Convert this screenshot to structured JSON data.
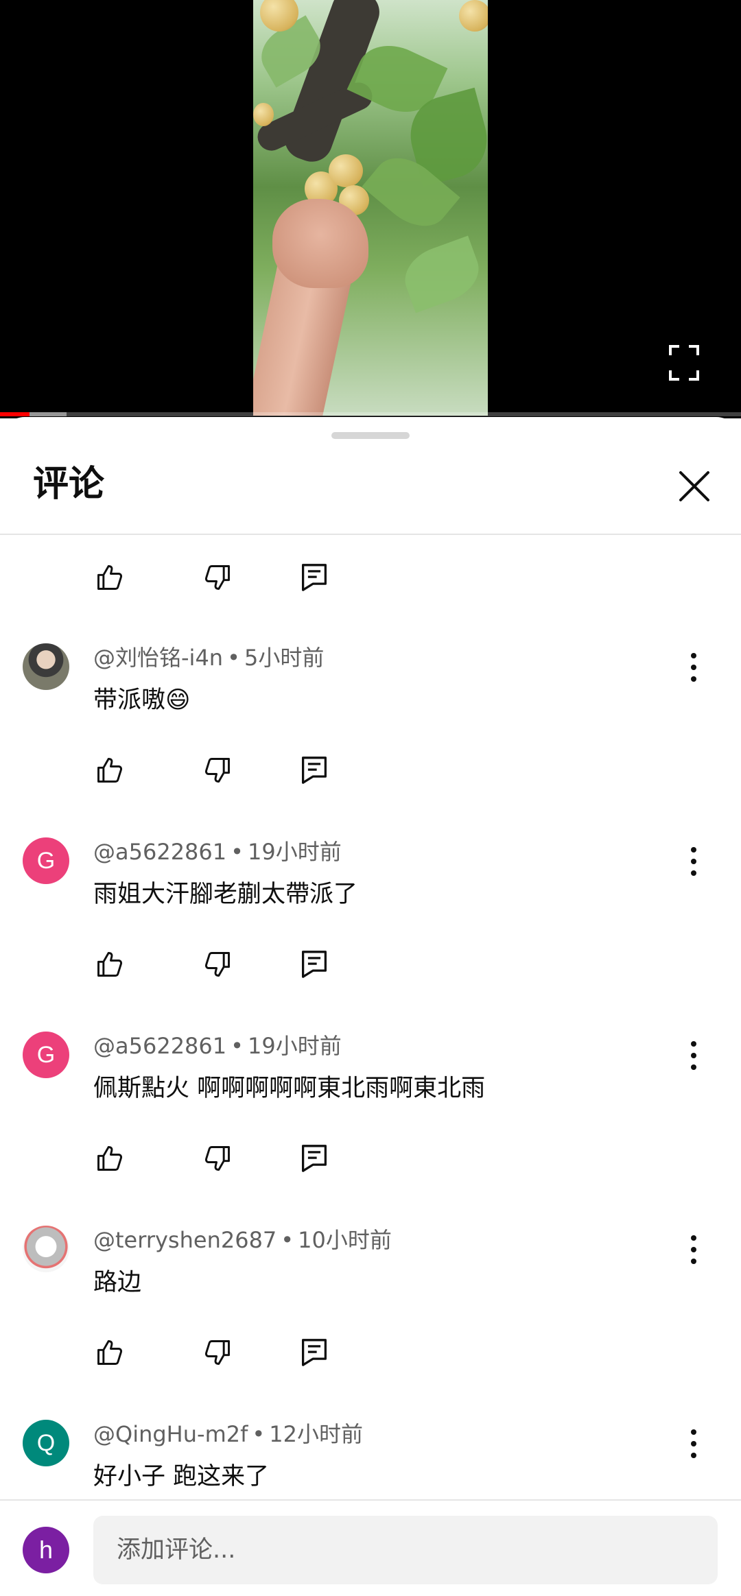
{
  "video": {
    "progress_played": 0.04,
    "progress_buffered": 0.09
  },
  "sheet": {
    "title": "评论"
  },
  "comments": [
    {
      "author": "@刘怡铭-i4n",
      "time": "5小时前",
      "text": "带派嗷😄",
      "avatar_letter": "",
      "avatar_color": "#5a5a5a"
    },
    {
      "author": "@a5622861",
      "time": "19小时前",
      "text": "雨姐大汗腳老蒯太帶派了",
      "avatar_letter": "G",
      "avatar_color": "#ec407a"
    },
    {
      "author": "@a5622861",
      "time": "19小时前",
      "text": "佩斯點火 啊啊啊啊啊東北雨啊東北雨",
      "avatar_letter": "G",
      "avatar_color": "#ec407a"
    },
    {
      "author": "@terryshen2687",
      "time": "10小时前",
      "text": "路边",
      "avatar_letter": "",
      "avatar_color": "#e0e0e0"
    },
    {
      "author": "@QingHu-m2f",
      "time": "12小时前",
      "text": "好小子 跑这来了",
      "avatar_letter": "Q",
      "avatar_color": "#00897b"
    }
  ],
  "separator": "•",
  "input": {
    "placeholder": "添加评论...",
    "avatar_letter": "h",
    "avatar_color": "#7b1fa2"
  },
  "icons": {
    "like": "thumb-up-icon",
    "dislike": "thumb-down-icon",
    "reply": "reply-icon",
    "more": "more-vert-icon",
    "close": "close-icon",
    "fullscreen": "fullscreen-icon"
  }
}
